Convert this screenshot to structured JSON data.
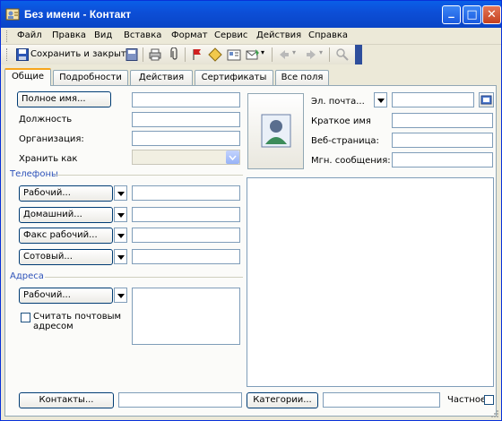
{
  "window": {
    "title": "Без имени - Контакт"
  },
  "titlebar": {
    "minimize": "_",
    "maximize": "□",
    "close": "✕"
  },
  "menu": [
    "Файл",
    "Правка",
    "Вид",
    "Вставка",
    "Формат",
    "Сервис",
    "Действия",
    "Справка"
  ],
  "toolbar": {
    "save_close_label": "Сохранить и закрыть"
  },
  "tabs": [
    "Общие",
    "Подробности",
    "Действия",
    "Сертификаты",
    "Все поля"
  ],
  "general": {
    "full_name_button": "Полное имя...",
    "job_title_label": "Должность",
    "company_label": "Организация:",
    "file_as_label": "Хранить как",
    "phones_group": "Телефоны",
    "phone_buttons": [
      "Рабочий...",
      "Домашний...",
      "Факс рабочий...",
      "Сотовый..."
    ],
    "address_group": "Адреса",
    "address_button": "Рабочий...",
    "mailing_address_checkbox": "Считать почтовым адресом",
    "email_button": "Эл. почта...",
    "display_as_label": "Краткое имя",
    "web_page_label": "Веб-страница:",
    "im_label": "Мгн. сообщения:",
    "contacts_button": "Контакты...",
    "categories_button": "Категории...",
    "private_label": "Частное"
  },
  "icons": {
    "window": "contact-card-icon",
    "save": "floppy-icon",
    "photo": "contact-photo-icon"
  },
  "colors": {
    "titlebar": "#0A5FE8",
    "window_bg": "#ECE9D8",
    "panel_bg": "#FBFBF9",
    "active_tab_accent": "#F7A51B"
  }
}
